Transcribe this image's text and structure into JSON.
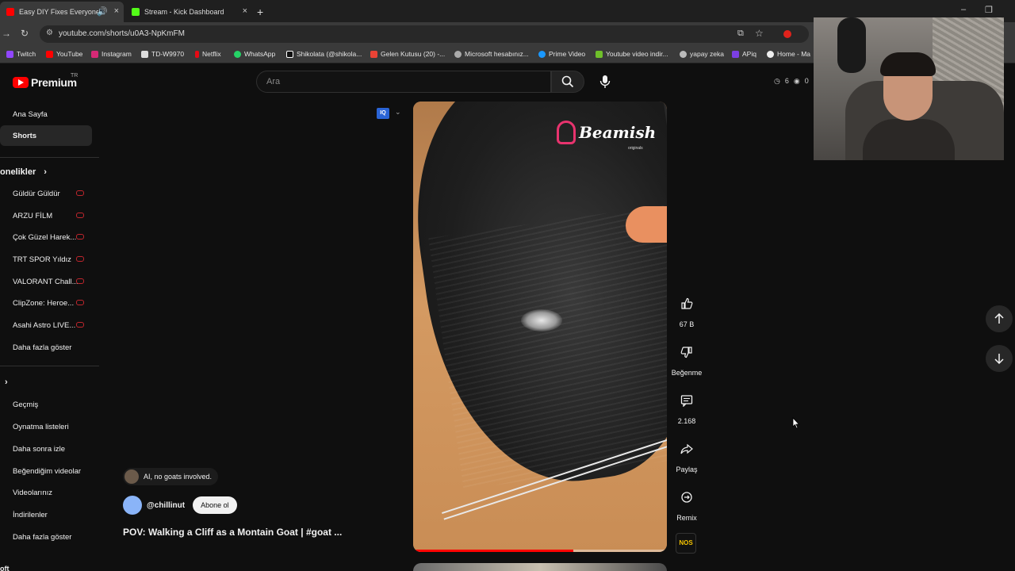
{
  "browser": {
    "tabs": [
      {
        "title": "Easy DIY Fixes Everyone Sh",
        "active": true
      },
      {
        "title": "Stream - Kick Dashboard",
        "active": false
      }
    ],
    "new_tab": "+",
    "url": "youtube.com/shorts/u0A3-NpKmFM",
    "bookmarks": [
      "Twitch",
      "YouTube",
      "Instagram",
      "TD-W9970",
      "Netflix",
      "WhatsApp",
      "Shikolata (@shikola...",
      "Gelen Kutusu (20) -...",
      "Microsoft hesabınız...",
      "Prime Video",
      "Youtube video indir...",
      "yapay zeka",
      "APiq",
      "Home - Ma"
    ]
  },
  "header": {
    "logo_text": "Premium",
    "country": "TR",
    "search_placeholder": "Ara",
    "counts": [
      "6",
      "0"
    ]
  },
  "sidebar": {
    "home": "Ana Sayfa",
    "shorts": "Shorts",
    "subscriptions_title": "onelikler",
    "channels": [
      "Güldür Güldür",
      "ARZU FİLM",
      "Çok Güzel Harek...",
      "TRT SPOR Yıldız",
      "VALORANT Chall...",
      "ClipZone: Heroe...",
      "Asahi Astro LIVE..."
    ],
    "show_more_1": "Daha fazla göster",
    "you_items": [
      "Geçmiş",
      "Oynatma listeleri",
      "Daha sonra izle",
      "Beğendiğim videolar",
      "Videolarınız",
      "İndirilenler"
    ],
    "show_more_2": "Daha fazla göster",
    "bottom_partial": "oft"
  },
  "video": {
    "brand": "Beamish",
    "brand_sub": "originals",
    "progress": 0.63,
    "quality_badge": "IQ"
  },
  "actions": {
    "likes": "67 B",
    "dislike": "Beğenme",
    "comments": "2.168",
    "share": "Paylaş",
    "remix": "Remix",
    "sound_avatar": "NOS"
  },
  "meta": {
    "comment_chip": "AI, no goats involved.",
    "channel": "@chillinut",
    "subscribe": "Abone ol",
    "title": "POV: Walking a Cliff as a Montain Goat | #goat ..."
  }
}
